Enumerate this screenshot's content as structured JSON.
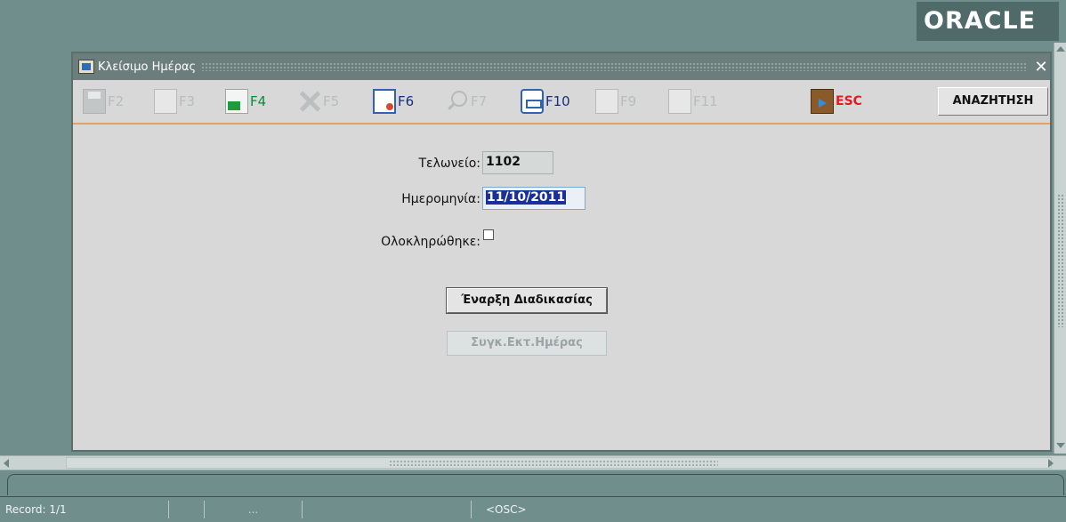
{
  "brand": {
    "logo_text": "ORACLE"
  },
  "window": {
    "title": "Κλείσιμο Ημέρας",
    "close_glyph": "✕"
  },
  "toolbar": {
    "buttons": [
      {
        "key": "F2",
        "icon": "save-icon",
        "enabled": false
      },
      {
        "key": "F3",
        "icon": "copy-doc-icon",
        "enabled": false
      },
      {
        "key": "F4",
        "icon": "new-doc-icon",
        "enabled": true
      },
      {
        "key": "F5",
        "icon": "delete-icon",
        "enabled": false
      },
      {
        "key": "F6",
        "icon": "clear-doc-icon",
        "enabled": true
      },
      {
        "key": "F7",
        "icon": "query-icon",
        "enabled": false
      },
      {
        "key": "F10",
        "icon": "print-icon",
        "enabled": true
      },
      {
        "key": "F9",
        "icon": "insert-doc-icon",
        "enabled": false
      },
      {
        "key": "F11",
        "icon": "delete-doc-icon",
        "enabled": false
      }
    ],
    "exit_label": "ESC",
    "search_label": "ΑΝΑΖΗΤΗΣΗ"
  },
  "form": {
    "customs_office_label": "Τελωνείο:",
    "customs_office_value": "1102",
    "date_label": "Ημερομηνία:",
    "date_value": "11/10/2011",
    "completed_label": "Ολοκληρώθηκε:",
    "completed_checked": false
  },
  "actions": {
    "start_process_label": "Έναρξη Διαδικασίας",
    "day_summary_label": "Συγκ.Εκτ.Ημέρας"
  },
  "statusbar": {
    "record": "Record: 1/1",
    "ellipsis": "...",
    "mode": "<OSC>"
  },
  "colors": {
    "background": "#6f8e8c",
    "window_bg": "#d8d8d8",
    "enabled_key": "#0d8a36",
    "disabled_key": "#b7bcbc",
    "esc": "#e01c1c",
    "selection": "#1b2f9c"
  }
}
